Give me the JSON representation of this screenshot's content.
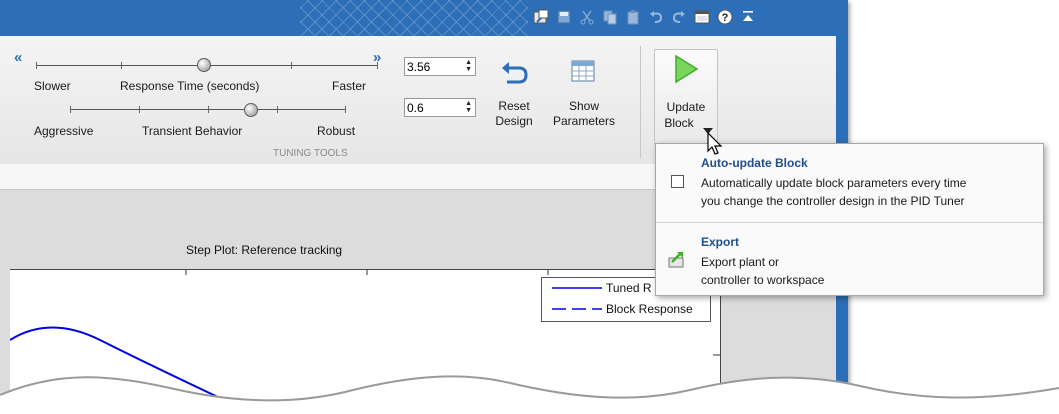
{
  "colors": {
    "titlebar": "#2c6fb8",
    "menu_title": "#1f4e8c",
    "plot_line": "#0000e6",
    "run_icon": "#3fae2a"
  },
  "quick_access": {
    "icons": [
      "undock-icon",
      "save-icon",
      "cut-icon",
      "copy-icon",
      "paste-icon",
      "undo-icon",
      "redo-icon",
      "layout-icon",
      "help-icon",
      "minimize-ribbon-icon"
    ]
  },
  "tuning": {
    "response_time": {
      "left_label": "Slower",
      "center_label": "Response Time (seconds)",
      "right_label": "Faster",
      "value": "3.56",
      "slider_position": 0.45
    },
    "transient": {
      "left_label": "Aggressive",
      "center_label": "Transient Behavior",
      "right_label": "Robust",
      "value": "0.6",
      "slider_position": 0.6
    },
    "collapse_left": "«",
    "collapse_right": "»",
    "group_label": "TUNING TOOLS"
  },
  "tools": {
    "reset": {
      "line1": "Reset",
      "line2": "Design"
    },
    "show": {
      "line1": "Show",
      "line2": "Parameters"
    },
    "update": {
      "line1": "Update",
      "line2": "Block"
    }
  },
  "plot": {
    "title": "Step Plot: Reference tracking",
    "legend": [
      {
        "label": "Tuned R",
        "style": "solid"
      },
      {
        "label": "Block Response",
        "style": "dashed"
      }
    ]
  },
  "menu": {
    "auto_update": {
      "title": "Auto-update Block",
      "desc1": "Automatically update block parameters every time",
      "desc2": "you  change the controller design in the PID Tuner",
      "checked": false
    },
    "export": {
      "title": "Export",
      "desc1": "Export plant or",
      "desc2": "controller to workspace"
    }
  }
}
